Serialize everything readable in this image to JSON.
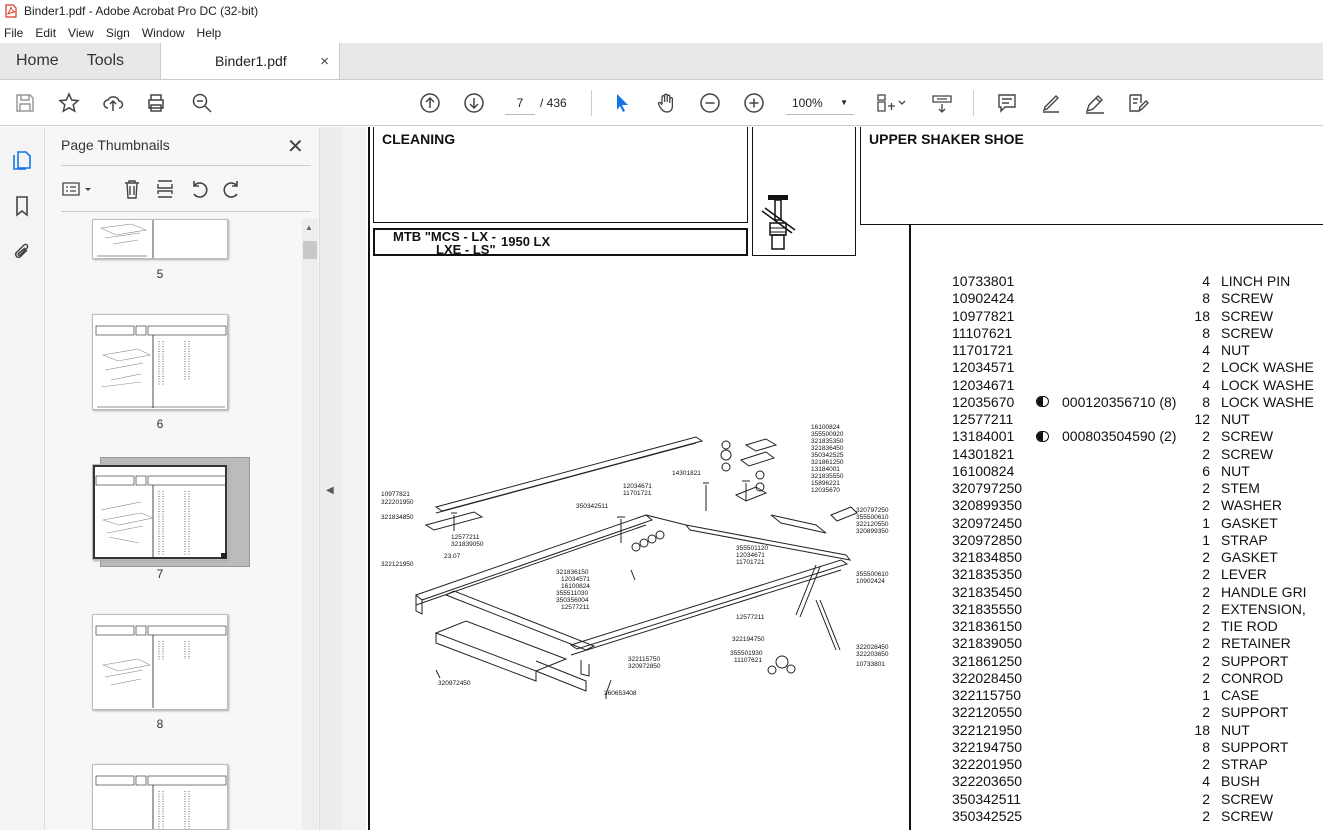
{
  "window": {
    "title": "Binder1.pdf - Adobe Acrobat Pro DC (32-bit)"
  },
  "menu": [
    "File",
    "Edit",
    "View",
    "Sign",
    "Window",
    "Help"
  ],
  "tabs": {
    "home": "Home",
    "tools": "Tools",
    "document": "Binder1.pdf",
    "close": "×"
  },
  "toolbar": {
    "current_page": "7",
    "page_total": "/ 436",
    "zoom": "100%"
  },
  "sidebar": {
    "title": "Page Thumbnails",
    "thumbnails": [
      {
        "label": "5"
      },
      {
        "label": "6"
      },
      {
        "label": "7",
        "selected": true
      },
      {
        "label": "8"
      }
    ]
  },
  "page": {
    "section_title": "CLEANING",
    "model_line1": "MTB \"MCS - LX -",
    "model_line2": "LXE - LS\"",
    "model_number": "1950 LX",
    "part_title": "UPPER SHAKER SHOE",
    "diagram_callouts": [
      "16100824",
      "355500920",
      "321835350",
      "321836450",
      "350342525",
      "321861250",
      "13184001",
      "321835550",
      "15896221",
      "12035670",
      "14301821",
      "12034671",
      "11701721",
      "10977821",
      "322201950",
      "321834850",
      "350342511",
      "12577211",
      "321839050",
      "23.07",
      "322121950",
      "320797250",
      "355500610",
      "322120550",
      "320899350",
      "355501120",
      "12034671",
      "11701721",
      "321836150",
      "12034571",
      "16100824",
      "355511030",
      "350356004",
      "12577211",
      "355500610",
      "10902424",
      "12577211",
      "322194750",
      "355501930",
      "11107621",
      "322028450",
      "322203650",
      "10733801",
      "322115750",
      "320972850",
      "320972450",
      "360653408"
    ],
    "parts": [
      {
        "pn": "10733801",
        "ref": "",
        "qty": "4",
        "desc": "LINCH PIN"
      },
      {
        "pn": "10902424",
        "ref": "",
        "qty": "8",
        "desc": "SCREW"
      },
      {
        "pn": "10977821",
        "ref": "",
        "qty": "18",
        "desc": "SCREW"
      },
      {
        "pn": "11107621",
        "ref": "",
        "qty": "8",
        "desc": "SCREW"
      },
      {
        "pn": "11701721",
        "ref": "",
        "qty": "4",
        "desc": "NUT"
      },
      {
        "pn": "12034571",
        "ref": "",
        "qty": "2",
        "desc": "LOCK WASHE"
      },
      {
        "pn": "12034671",
        "ref": "",
        "qty": "4",
        "desc": "LOCK WASHE"
      },
      {
        "pn": "12035670",
        "ref": "000120356710  (8)",
        "qty": "8",
        "desc": "LOCK WASHE"
      },
      {
        "pn": "12577211",
        "ref": "",
        "qty": "12",
        "desc": "NUT"
      },
      {
        "pn": "13184001",
        "ref": "000803504590  (2)",
        "qty": "2",
        "desc": "SCREW"
      },
      {
        "pn": "14301821",
        "ref": "",
        "qty": "2",
        "desc": "SCREW"
      },
      {
        "pn": "16100824",
        "ref": "",
        "qty": "6",
        "desc": "NUT"
      },
      {
        "pn": "320797250",
        "ref": "",
        "qty": "2",
        "desc": "STEM"
      },
      {
        "pn": "320899350",
        "ref": "",
        "qty": "2",
        "desc": "WASHER"
      },
      {
        "pn": "320972450",
        "ref": "",
        "qty": "1",
        "desc": "GASKET"
      },
      {
        "pn": "320972850",
        "ref": "",
        "qty": "1",
        "desc": "STRAP"
      },
      {
        "pn": "321834850",
        "ref": "",
        "qty": "2",
        "desc": "GASKET"
      },
      {
        "pn": "321835350",
        "ref": "",
        "qty": "2",
        "desc": "LEVER"
      },
      {
        "pn": "321835450",
        "ref": "",
        "qty": "2",
        "desc": "HANDLE GRI"
      },
      {
        "pn": "321835550",
        "ref": "",
        "qty": "2",
        "desc": "EXTENSION,"
      },
      {
        "pn": "321836150",
        "ref": "",
        "qty": "2",
        "desc": "TIE ROD"
      },
      {
        "pn": "321839050",
        "ref": "",
        "qty": "2",
        "desc": "RETAINER"
      },
      {
        "pn": "321861250",
        "ref": "",
        "qty": "2",
        "desc": "SUPPORT"
      },
      {
        "pn": "322028450",
        "ref": "",
        "qty": "2",
        "desc": "CONROD"
      },
      {
        "pn": "322115750",
        "ref": "",
        "qty": "1",
        "desc": "CASE"
      },
      {
        "pn": "322120550",
        "ref": "",
        "qty": "2",
        "desc": "SUPPORT"
      },
      {
        "pn": "322121950",
        "ref": "",
        "qty": "18",
        "desc": "NUT"
      },
      {
        "pn": "322194750",
        "ref": "",
        "qty": "8",
        "desc": "SUPPORT"
      },
      {
        "pn": "322201950",
        "ref": "",
        "qty": "2",
        "desc": "STRAP"
      },
      {
        "pn": "322203650",
        "ref": "",
        "qty": "4",
        "desc": "BUSH"
      },
      {
        "pn": "350342511",
        "ref": "",
        "qty": "2",
        "desc": "SCREW"
      },
      {
        "pn": "350342525",
        "ref": "",
        "qty": "2",
        "desc": "SCREW"
      }
    ]
  }
}
